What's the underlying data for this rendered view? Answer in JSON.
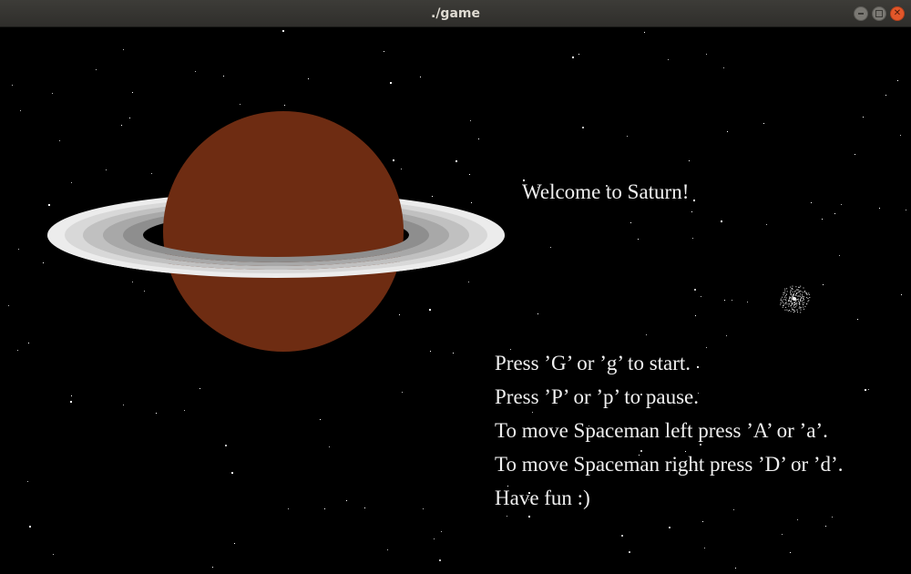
{
  "window": {
    "title": "./game",
    "controls": {
      "minimize_icon": "minimize-icon",
      "maximize_icon": "maximize-icon",
      "close_icon": "close-icon"
    }
  },
  "game": {
    "welcome": "Welcome to Saturn!",
    "instructions": [
      "Press ’G’ or ’g’ to start.",
      "Press ’P’ or ’p’ to pause.",
      "To move Spaceman left press ’A’ or ’a’.",
      "To move Spaceman right press ’D’ or ’d’.",
      "Have fun :)"
    ]
  },
  "colors": {
    "background": "#000000",
    "planet": "#6e2c12",
    "ring_outer": "#ececec",
    "ring_mid": "#c8c8c8",
    "ring_inner": "#9a9a9a",
    "text": "#f0f0f0"
  }
}
